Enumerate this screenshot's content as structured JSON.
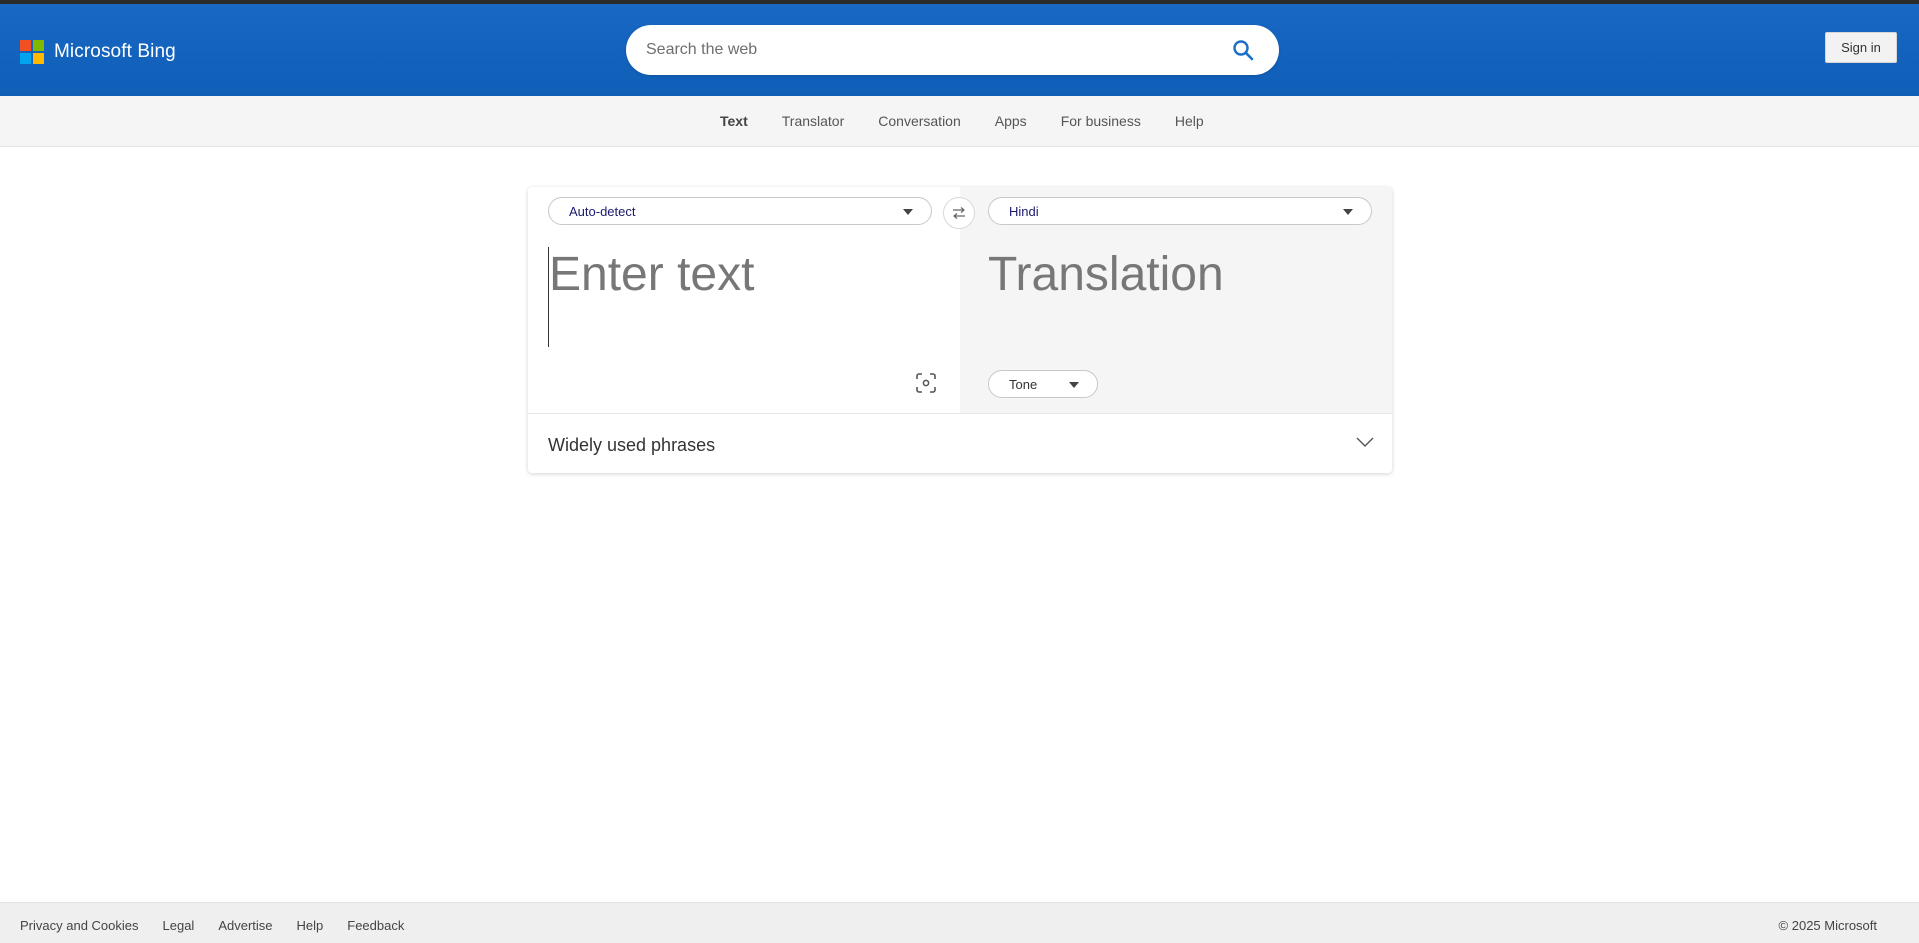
{
  "header": {
    "brand": "Microsoft Bing",
    "search_placeholder": "Search the web",
    "signin_label": "Sign in"
  },
  "nav": {
    "items": [
      {
        "label": "Text",
        "active": true
      },
      {
        "label": "Translator"
      },
      {
        "label": "Conversation"
      },
      {
        "label": "Apps"
      },
      {
        "label": "For business"
      },
      {
        "label": "Help"
      }
    ]
  },
  "translator": {
    "source_lang": "Auto-detect",
    "target_lang": "Hindi",
    "input_placeholder": "Enter text",
    "output_placeholder": "Translation",
    "tone_label": "Tone",
    "phrases_label": "Widely used phrases"
  },
  "footer": {
    "links": [
      "Privacy and Cookies",
      "Legal",
      "Advertise",
      "Help",
      "Feedback"
    ],
    "copyright": "© 2025 Microsoft"
  },
  "colors": {
    "header_blue": "#1868c4",
    "accent": "#1a1a6e",
    "logo": [
      "#f25022",
      "#7fba00",
      "#00a4ef",
      "#ffb900"
    ]
  },
  "icons": [
    "microsoft-logo-icon",
    "search-icon",
    "swap-icon",
    "camera-icon",
    "chevron-down-icon"
  ]
}
